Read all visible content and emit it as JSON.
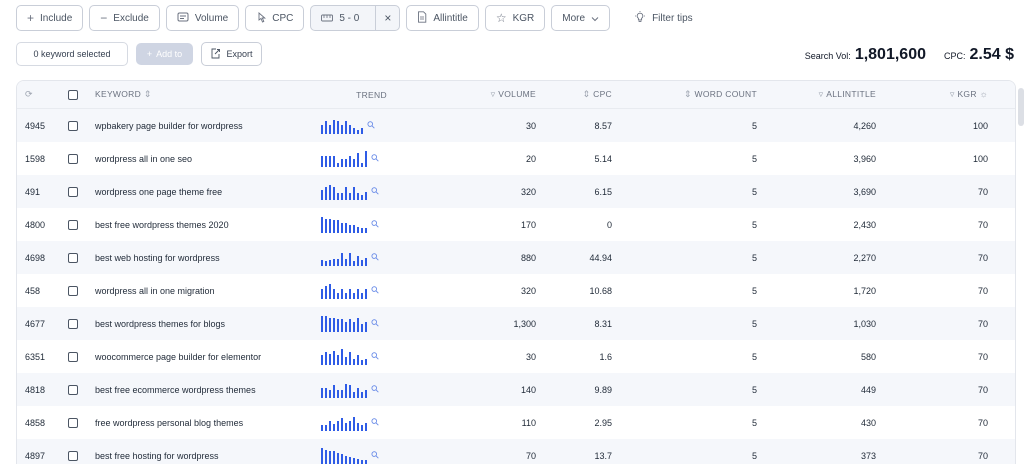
{
  "toolbar": {
    "include": "Include",
    "exclude": "Exclude",
    "volume": "Volume",
    "cpc": "CPC",
    "range": "5 - 0",
    "allintitle": "Allintitle",
    "kgr": "KGR",
    "more": "More",
    "filter_tips": "Filter tips"
  },
  "selection": {
    "keyword_selected": "0 keyword selected",
    "add_to": "Add to",
    "export": "Export"
  },
  "stats": {
    "search_vol_label": "Search Vol:",
    "search_vol_value": "1,801,600",
    "cpc_label": "CPC:",
    "cpc_value": "2.54 $"
  },
  "table": {
    "headers": {
      "keyword": "KEYWORD",
      "trend": "TREND",
      "volume": "VOLUME",
      "cpc": "CPC",
      "word_count": "WORD COUNT",
      "allintitle": "ALLINTITLE",
      "kgr": "KGR"
    },
    "rows": [
      {
        "id": "4945",
        "keyword": "wpbakery page builder for wordpress",
        "volume": "30",
        "cpc": "8.57",
        "word_count": "5",
        "allintitle": "4,260",
        "kgr": "100",
        "trend": [
          0.55,
          0.8,
          0.55,
          0.9,
          0.8,
          0.55,
          0.8,
          0.55,
          0.35,
          0.25,
          0.35
        ]
      },
      {
        "id": "1598",
        "keyword": "wordpress all in one seo",
        "volume": "20",
        "cpc": "5.14",
        "word_count": "5",
        "allintitle": "3,960",
        "kgr": "100",
        "trend": [
          0.7,
          0.7,
          0.7,
          0.7,
          0.25,
          0.5,
          0.5,
          0.7,
          0.5,
          0.9,
          0.25,
          1.0
        ]
      },
      {
        "id": "491",
        "keyword": "wordpress one page theme free",
        "volume": "320",
        "cpc": "6.15",
        "word_count": "5",
        "allintitle": "3,690",
        "kgr": "70",
        "trend": [
          0.6,
          0.8,
          0.95,
          0.8,
          0.45,
          0.45,
          0.8,
          0.45,
          0.8,
          0.45,
          0.3,
          0.5
        ]
      },
      {
        "id": "4800",
        "keyword": "best free wordpress themes 2020",
        "volume": "170",
        "cpc": "0",
        "word_count": "5",
        "allintitle": "2,430",
        "kgr": "70",
        "trend": [
          1.0,
          0.9,
          0.9,
          0.8,
          0.8,
          0.65,
          0.65,
          0.5,
          0.5,
          0.35,
          0.3,
          0.3
        ]
      },
      {
        "id": "4698",
        "keyword": "best web hosting for wordpress",
        "volume": "880",
        "cpc": "44.94",
        "word_count": "5",
        "allintitle": "2,270",
        "kgr": "70",
        "trend": [
          0.35,
          0.3,
          0.35,
          0.45,
          0.45,
          0.8,
          0.45,
          0.8,
          0.3,
          0.6,
          0.4,
          0.5
        ]
      },
      {
        "id": "458",
        "keyword": "wordpress all in one migration",
        "volume": "320",
        "cpc": "10.68",
        "word_count": "5",
        "allintitle": "1,720",
        "kgr": "70",
        "trend": [
          0.6,
          0.8,
          0.95,
          0.6,
          0.4,
          0.6,
          0.4,
          0.6,
          0.4,
          0.6,
          0.4,
          0.6
        ]
      },
      {
        "id": "4677",
        "keyword": "best wordpress themes for blogs",
        "volume": "1,300",
        "cpc": "8.31",
        "word_count": "5",
        "allintitle": "1,030",
        "kgr": "70",
        "trend": [
          1.0,
          1.0,
          0.9,
          0.9,
          0.8,
          0.8,
          0.65,
          0.8,
          0.65,
          0.9,
          0.5,
          0.6
        ]
      },
      {
        "id": "6351",
        "keyword": "woocommerce page builder for elementor",
        "volume": "30",
        "cpc": "1.6",
        "word_count": "5",
        "allintitle": "580",
        "kgr": "70",
        "trend": [
          0.6,
          0.8,
          0.7,
          0.9,
          0.6,
          1.0,
          0.5,
          0.8,
          0.4,
          0.6,
          0.3,
          0.4
        ]
      },
      {
        "id": "4818",
        "keyword": "best free ecommerce wordpress themes",
        "volume": "140",
        "cpc": "9.89",
        "word_count": "5",
        "allintitle": "449",
        "kgr": "70",
        "trend": [
          0.6,
          0.6,
          0.5,
          0.8,
          0.5,
          0.5,
          0.9,
          0.8,
          0.4,
          0.6,
          0.4,
          0.5
        ]
      },
      {
        "id": "4858",
        "keyword": "free wordpress personal blog themes",
        "volume": "110",
        "cpc": "2.95",
        "word_count": "5",
        "allintitle": "430",
        "kgr": "70",
        "trend": [
          0.35,
          0.4,
          0.6,
          0.45,
          0.6,
          0.8,
          0.5,
          0.6,
          0.9,
          0.5,
          0.4,
          0.5
        ]
      },
      {
        "id": "4897",
        "keyword": "best free hosting for wordpress",
        "volume": "70",
        "cpc": "13.7",
        "word_count": "5",
        "allintitle": "373",
        "kgr": "70",
        "trend": [
          1.0,
          0.9,
          0.8,
          0.8,
          0.7,
          0.6,
          0.5,
          0.45,
          0.35,
          0.3,
          0.25,
          0.25
        ]
      }
    ]
  }
}
